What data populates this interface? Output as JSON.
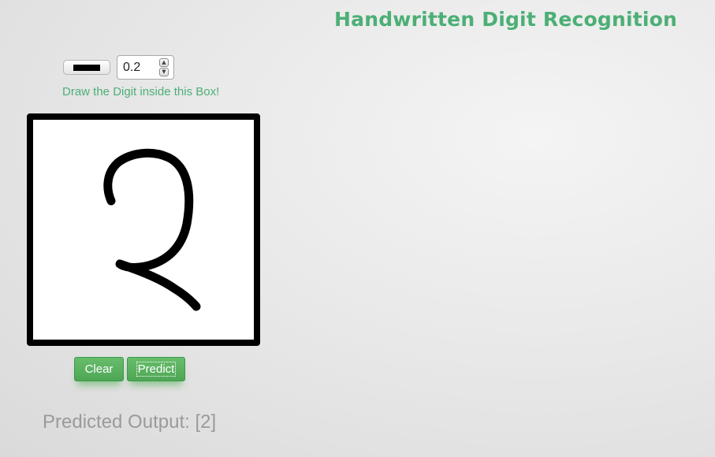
{
  "app": {
    "title": "Handwritten Digit Recognition"
  },
  "toolbar": {
    "brush_color": "#000000",
    "brush_color_icon": "color-swatch-icon",
    "stroke_width": "0.2",
    "spin_up_icon": "chevron-up-icon",
    "spin_down_icon": "chevron-down-icon"
  },
  "instruction": "Draw the Digit inside this Box!",
  "canvas": {
    "drawn_digit": "2",
    "border_color": "#000000",
    "background": "#ffffff"
  },
  "buttons": {
    "clear_label": "Clear",
    "predict_label": "Predict"
  },
  "result": {
    "text": "Predicted Output: [2]"
  },
  "colors": {
    "accent": "#4caf76",
    "button": "#55ad5b",
    "result_text": "#9a9a9a"
  }
}
